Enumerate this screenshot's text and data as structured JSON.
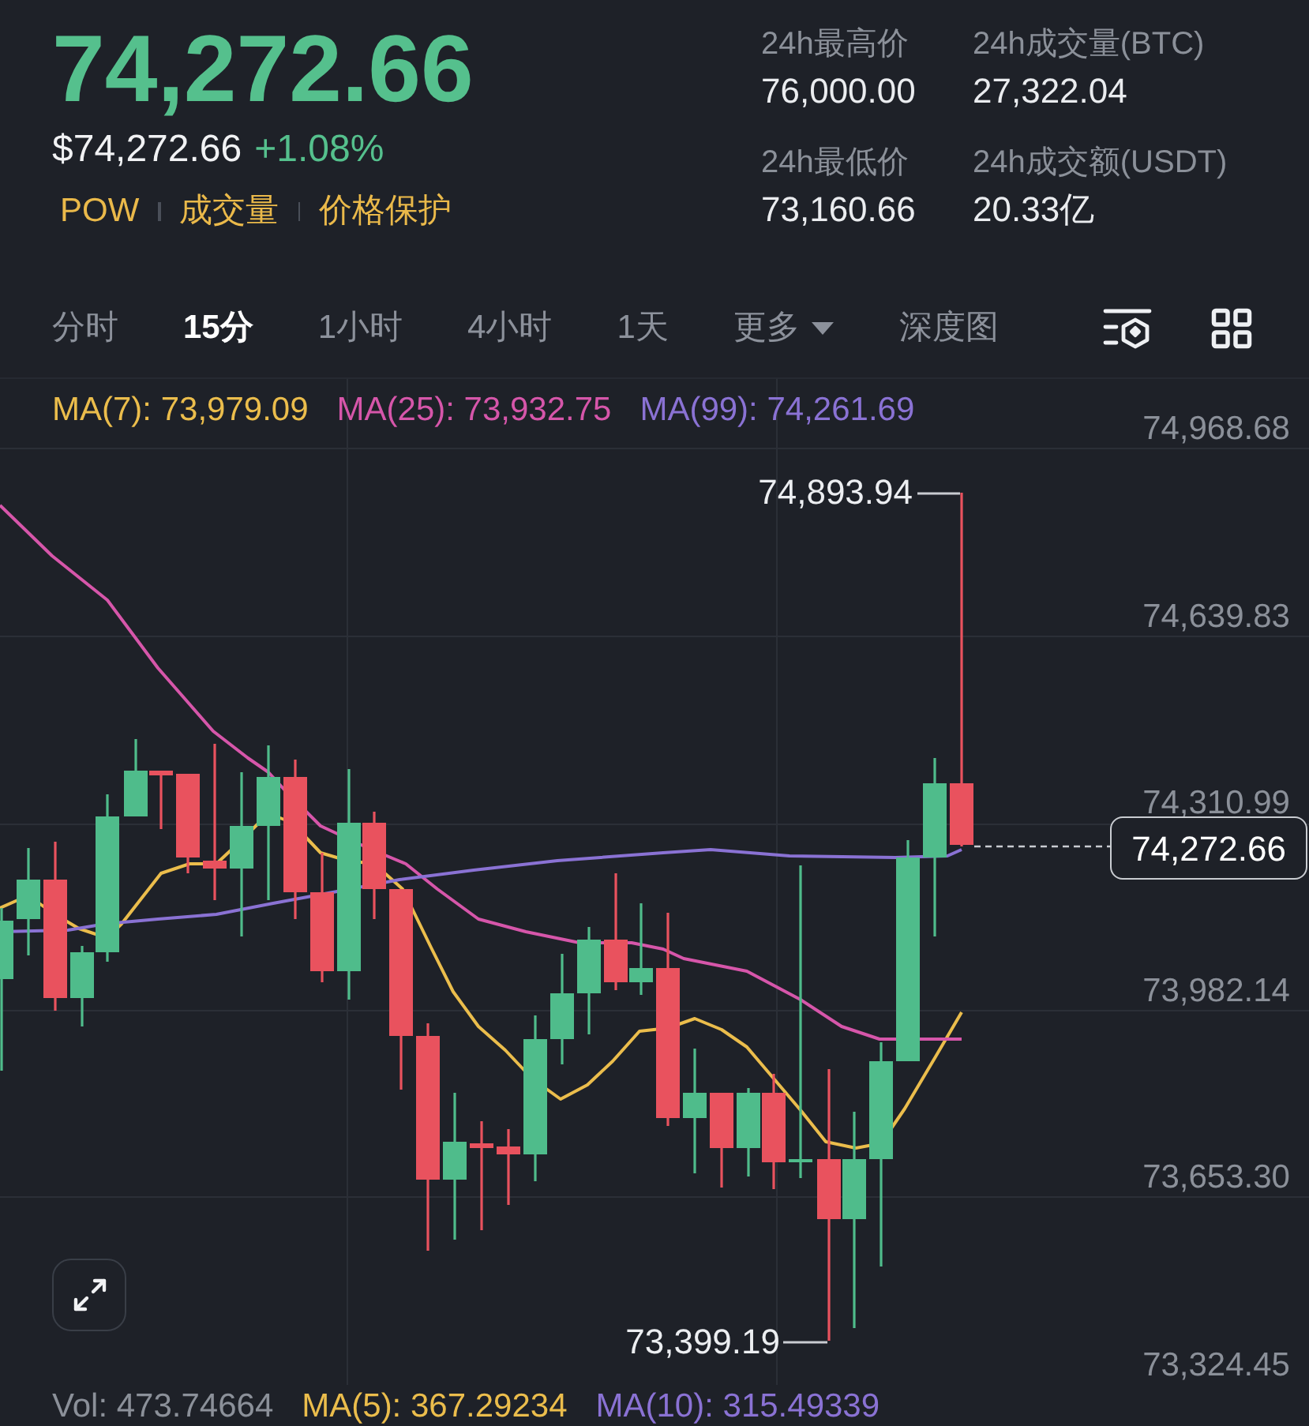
{
  "ticker": {
    "last_price": "74,272.66",
    "rising": true,
    "price_usd": "$74,272.66",
    "change": "+1.08%",
    "tags": [
      "POW",
      "成交量",
      "价格保护"
    ]
  },
  "stats": [
    {
      "label": "24h最高价",
      "value": "76,000.00"
    },
    {
      "label": "24h成交量(BTC)",
      "value": "27,322.04"
    },
    {
      "label": "24h最低价",
      "value": "73,160.66"
    },
    {
      "label": "24h成交额(USDT)",
      "value": "20.33亿"
    }
  ],
  "interval_tabs": [
    {
      "label": "分时",
      "selected": false,
      "kind": "tab"
    },
    {
      "label": "15分",
      "selected": true,
      "kind": "tab"
    },
    {
      "label": "1小时",
      "selected": false,
      "kind": "tab"
    },
    {
      "label": "4小时",
      "selected": false,
      "kind": "tab"
    },
    {
      "label": "1天",
      "selected": false,
      "kind": "tab"
    },
    {
      "label": "更多",
      "selected": false,
      "kind": "dropdown"
    },
    {
      "label": "深度图",
      "selected": false,
      "kind": "tab"
    }
  ],
  "chart": {
    "indicators": [
      {
        "label": "MA(7): 73,979.09",
        "color": "#ebbd4c"
      },
      {
        "label": "MA(25): 73,932.75",
        "color": "#d656aa"
      },
      {
        "label": "MA(99): 74,261.69",
        "color": "#8a72d4"
      }
    ],
    "price_axis": [
      "74,968.68",
      "74,639.83",
      "74,310.99",
      "73,982.14",
      "73,653.30",
      "73,324.45"
    ],
    "high_label": "74,893.94",
    "low_label": "73,399.19",
    "current_price": "74,272.66"
  },
  "volume_panel": {
    "indicators": [
      {
        "label": "Vol: 473.74664",
        "color": "#8b9099"
      },
      {
        "label": "MA(5): 367.29234",
        "color": "#ebbd4c"
      },
      {
        "label": "MA(10): 315.49339",
        "color": "#8a72d4"
      }
    ]
  }
}
